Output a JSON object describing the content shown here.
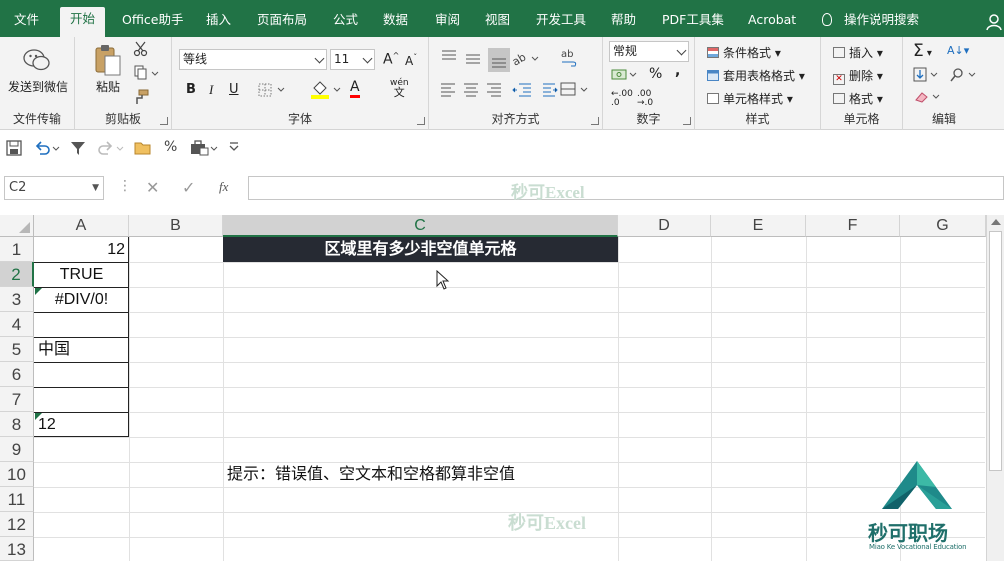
{
  "menu": {
    "tabs": [
      "文件",
      "开始",
      "Office助手",
      "插入",
      "页面布局",
      "公式",
      "数据",
      "审阅",
      "视图",
      "开发工具",
      "帮助",
      "PDF工具集",
      "Acrobat"
    ],
    "active": "开始",
    "tell_me": "操作说明搜索"
  },
  "ribbon": {
    "groups": {
      "file_transfer": "文件传输",
      "clipboard": "剪贴板",
      "font": "字体",
      "alignment": "对齐方式",
      "number": "数字",
      "styles": "样式",
      "cells": "单元格",
      "editing": "编辑"
    },
    "send_wechat": "发送到微信",
    "paste": "粘贴",
    "font_name": "等线",
    "font_size": "11",
    "bold": "B",
    "italic": "I",
    "underline": "U",
    "font_color_glyph": "A",
    "phonetic": "wén",
    "number_format": "常规",
    "percent": "%",
    "comma": ",",
    "inc_decimal": ".00",
    "conditional_format": "条件格式",
    "table_format": "套用表格格式",
    "cell_styles": "单元格样式",
    "insert": "插入",
    "delete": "删除",
    "format": "格式",
    "sum_glyph": "Σ"
  },
  "formula_bar": {
    "name_box": "C2",
    "fx": "fx",
    "watermark": "秒可Excel"
  },
  "sheet": {
    "columns": [
      "A",
      "B",
      "C",
      "D",
      "E",
      "F",
      "G"
    ],
    "rows": [
      "1",
      "2",
      "3",
      "4",
      "5",
      "6",
      "7",
      "8",
      "9",
      "10",
      "11",
      "12",
      "13"
    ],
    "a1": "12",
    "a2": "TRUE",
    "a3": "#DIV/0!",
    "a5": "中国",
    "a8": "12",
    "c1_title": "区域里有多少非空值单元格",
    "c10_hint": "提示：错误值、空文本和空格都算非空值",
    "watermark": "秒可Excel"
  },
  "logo": {
    "name": "秒可职场",
    "tagline": "Miao Ke Vocational Education"
  },
  "colors": {
    "excel_green": "#217346",
    "title_fill": "#262a33",
    "watermark": "#c9ddd1"
  }
}
